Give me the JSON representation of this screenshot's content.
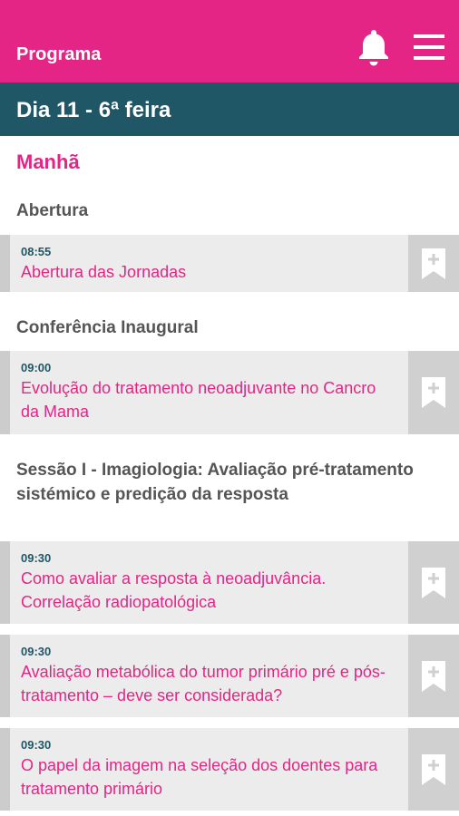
{
  "app_bar": {
    "title": "Programa",
    "icons": [
      "bell-icon",
      "menu-icon"
    ],
    "background": "#e42585"
  },
  "day_header": {
    "label": "Dia 11 - 6ª feira",
    "background": "#205766"
  },
  "period_label": "Manhã",
  "sections": [
    {
      "title": "Abertura",
      "sessions": [
        {
          "time": "08:55",
          "title": "Abertura das Jornadas"
        }
      ]
    },
    {
      "title": "Conferência Inaugural",
      "sessions": [
        {
          "time": "09:00",
          "title": "Evolução do tratamento neoadjuvante no Cancro da Mama"
        }
      ]
    },
    {
      "title": "Sessão I - Imagiologia: Avaliação pré-tratamento sistémico e predição da resposta",
      "sessions": [
        {
          "time": "09:30",
          "title": "Como avaliar a resposta à neoadjuvância. Correlação radiopatológica"
        },
        {
          "time": "09:30",
          "title": "Avaliação metabólica do tumor primário pré e pós-tratamento – deve ser considerada?"
        },
        {
          "time": "09:30",
          "title": "O papel da imagem na seleção dos doentes para tratamento primário"
        }
      ]
    }
  ],
  "colors": {
    "accent": "#e42585",
    "header_dark": "#205766",
    "card_background": "#ececec",
    "bookmark_background": "#d0d0d0"
  }
}
